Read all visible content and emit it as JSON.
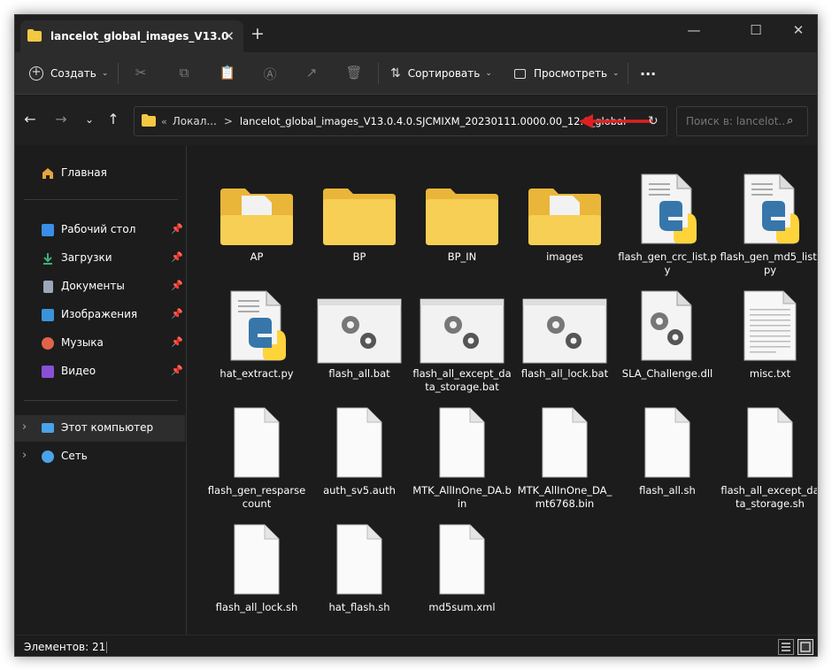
{
  "window": {
    "tab_title": "lancelot_global_images_V13.0",
    "new_tab_label": "+",
    "controls": {
      "minimize": "—",
      "maximize": "☐",
      "close": "✕"
    }
  },
  "toolbar": {
    "create_label": "Создать",
    "sort_label": "Сортировать",
    "view_label": "Просмотреть",
    "more_label": "···"
  },
  "address": {
    "crumb_overflow": "«",
    "crumb_parent": "Локал...",
    "crumb_separator": ">",
    "crumb_current": "lancelot_global_images_V13.0.4.0.SJCMIXM_20230111.0000.00_12.0_global",
    "search_placeholder": "Поиск в: lancelot..."
  },
  "sidebar": {
    "home": "Главная",
    "quick": [
      {
        "label": "Рабочий стол",
        "icon": "desktop-icon",
        "color": "#3a8ee6"
      },
      {
        "label": "Загрузки",
        "icon": "download-icon",
        "color": "#3fb07a"
      },
      {
        "label": "Документы",
        "icon": "documents-icon",
        "color": "#9aa8b8"
      },
      {
        "label": "Изображения",
        "icon": "pictures-icon",
        "color": "#3b93d9"
      },
      {
        "label": "Музыка",
        "icon": "music-icon",
        "color": "#e0634a"
      },
      {
        "label": "Видео",
        "icon": "video-icon",
        "color": "#8a4fd6"
      }
    ],
    "this_pc": "Этот компьютер",
    "network": "Сеть"
  },
  "files": [
    {
      "name": "AP",
      "type": "folder-doc"
    },
    {
      "name": "BP",
      "type": "folder"
    },
    {
      "name": "BP_IN",
      "type": "folder"
    },
    {
      "name": "images",
      "type": "folder-doc"
    },
    {
      "name": "flash_gen_crc_list.py",
      "type": "python"
    },
    {
      "name": "flash_gen_md5_list.py",
      "type": "python"
    },
    {
      "name": "hat_extract.py",
      "type": "python"
    },
    {
      "name": "flash_all.bat",
      "type": "bat"
    },
    {
      "name": "flash_all_except_data_storage.bat",
      "type": "bat"
    },
    {
      "name": "flash_all_lock.bat",
      "type": "bat"
    },
    {
      "name": "SLA_Challenge.dll",
      "type": "dll"
    },
    {
      "name": "misc.txt",
      "type": "txt"
    },
    {
      "name": "flash_gen_resparsecount",
      "type": "file"
    },
    {
      "name": "auth_sv5.auth",
      "type": "file"
    },
    {
      "name": "MTK_AllInOne_DA.bin",
      "type": "file"
    },
    {
      "name": "MTK_AllInOne_DA_mt6768.bin",
      "type": "file"
    },
    {
      "name": "flash_all.sh",
      "type": "file"
    },
    {
      "name": "flash_all_except_data_storage.sh",
      "type": "file"
    },
    {
      "name": "flash_all_lock.sh",
      "type": "file"
    },
    {
      "name": "hat_flash.sh",
      "type": "file"
    },
    {
      "name": "md5sum.xml",
      "type": "file"
    }
  ],
  "status": {
    "item_count": "Элементов: 21"
  },
  "colors": {
    "annotation_arrow": "#e02020",
    "folder": "#f5c842",
    "accent": "#0f6cbd"
  }
}
